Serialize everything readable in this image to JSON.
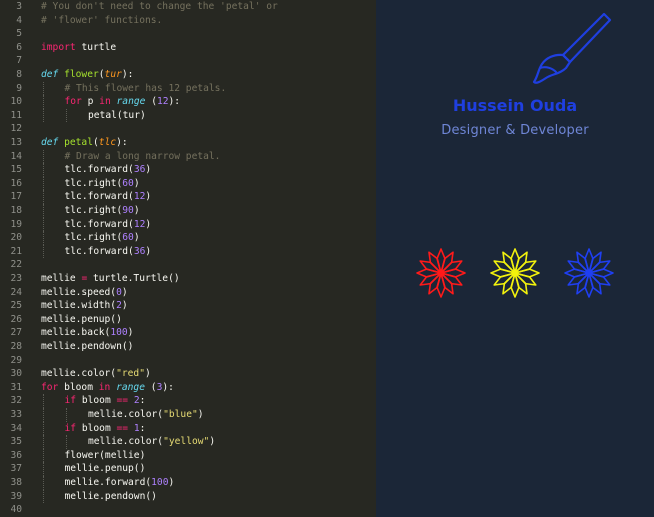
{
  "editor": {
    "lines": [
      {
        "n": "3",
        "indent": 0,
        "tokens": [
          [
            "cmt",
            "# You don't need to change the 'petal' or"
          ]
        ]
      },
      {
        "n": "4",
        "indent": 0,
        "tokens": [
          [
            "cmt",
            "# 'flower' functions."
          ]
        ]
      },
      {
        "n": "5",
        "indent": 0,
        "tokens": []
      },
      {
        "n": "6",
        "indent": 0,
        "tokens": [
          [
            "kw",
            "import"
          ],
          [
            "",
            "turtle"
          ]
        ]
      },
      {
        "n": "7",
        "indent": 0,
        "tokens": []
      },
      {
        "n": "8",
        "indent": 0,
        "tokens": [
          [
            "sto",
            "def"
          ],
          [
            "fn",
            "flower"
          ],
          [
            "",
            "("
          ],
          [
            "par",
            "tur"
          ],
          [
            "",
            "):"
          ]
        ]
      },
      {
        "n": "9",
        "indent": 1,
        "tokens": [
          [
            "cmt",
            "# This flower has 12 petals."
          ]
        ]
      },
      {
        "n": "10",
        "indent": 1,
        "tokens": [
          [
            "kw",
            "for"
          ],
          [
            "",
            "p "
          ],
          [
            "kw",
            "in"
          ],
          [
            "sto",
            "range"
          ],
          [
            "",
            "("
          ],
          [
            "num",
            "12"
          ],
          [
            "",
            "):"
          ]
        ]
      },
      {
        "n": "11",
        "indent": 2,
        "tokens": [
          [
            "",
            "petal(tur)"
          ]
        ]
      },
      {
        "n": "12",
        "indent": 0,
        "tokens": []
      },
      {
        "n": "13",
        "indent": 0,
        "tokens": [
          [
            "sto",
            "def"
          ],
          [
            "fn",
            "petal"
          ],
          [
            "",
            "("
          ],
          [
            "par",
            "tlc"
          ],
          [
            "",
            "):"
          ]
        ]
      },
      {
        "n": "14",
        "indent": 1,
        "tokens": [
          [
            "cmt",
            "# Draw a long narrow petal."
          ]
        ]
      },
      {
        "n": "15",
        "indent": 1,
        "tokens": [
          [
            "",
            "tlc.forward("
          ],
          [
            "num",
            "36"
          ],
          [
            "",
            ")"
          ]
        ]
      },
      {
        "n": "16",
        "indent": 1,
        "tokens": [
          [
            "",
            "tlc.right("
          ],
          [
            "num",
            "60"
          ],
          [
            "",
            ")"
          ]
        ]
      },
      {
        "n": "17",
        "indent": 1,
        "tokens": [
          [
            "",
            "tlc.forward("
          ],
          [
            "num",
            "12"
          ],
          [
            "",
            ")"
          ]
        ]
      },
      {
        "n": "18",
        "indent": 1,
        "tokens": [
          [
            "",
            "tlc.right("
          ],
          [
            "num",
            "90"
          ],
          [
            "",
            ")"
          ]
        ]
      },
      {
        "n": "19",
        "indent": 1,
        "tokens": [
          [
            "",
            "tlc.forward("
          ],
          [
            "num",
            "12"
          ],
          [
            "",
            ")"
          ]
        ]
      },
      {
        "n": "20",
        "indent": 1,
        "tokens": [
          [
            "",
            "tlc.right("
          ],
          [
            "num",
            "60"
          ],
          [
            "",
            ")"
          ]
        ]
      },
      {
        "n": "21",
        "indent": 1,
        "tokens": [
          [
            "",
            "tlc.forward("
          ],
          [
            "num",
            "36"
          ],
          [
            "",
            ")"
          ]
        ]
      },
      {
        "n": "22",
        "indent": 0,
        "tokens": []
      },
      {
        "n": "23",
        "indent": 0,
        "tokens": [
          [
            "",
            "mellie "
          ],
          [
            "kw",
            "="
          ],
          [
            "",
            "turtle.Turtle()"
          ]
        ]
      },
      {
        "n": "24",
        "indent": 0,
        "tokens": [
          [
            "",
            "mellie.speed("
          ],
          [
            "num",
            "0"
          ],
          [
            "",
            ")"
          ]
        ]
      },
      {
        "n": "25",
        "indent": 0,
        "tokens": [
          [
            "",
            "mellie.width("
          ],
          [
            "num",
            "2"
          ],
          [
            "",
            ")"
          ]
        ]
      },
      {
        "n": "26",
        "indent": 0,
        "tokens": [
          [
            "",
            "mellie.penup()"
          ]
        ]
      },
      {
        "n": "27",
        "indent": 0,
        "tokens": [
          [
            "",
            "mellie.back("
          ],
          [
            "num",
            "100"
          ],
          [
            "",
            ")"
          ]
        ]
      },
      {
        "n": "28",
        "indent": 0,
        "tokens": [
          [
            "",
            "mellie.pendown()"
          ]
        ]
      },
      {
        "n": "29",
        "indent": 0,
        "tokens": []
      },
      {
        "n": "30",
        "indent": 0,
        "tokens": [
          [
            "",
            "mellie.color("
          ],
          [
            "str",
            "\"red\""
          ],
          [
            "",
            ")"
          ]
        ]
      },
      {
        "n": "31",
        "indent": 0,
        "tokens": [
          [
            "kw",
            "for"
          ],
          [
            "",
            "bloom "
          ],
          [
            "kw",
            "in"
          ],
          [
            "sto",
            "range"
          ],
          [
            "",
            "("
          ],
          [
            "num",
            "3"
          ],
          [
            "",
            "):"
          ]
        ]
      },
      {
        "n": "32",
        "indent": 1,
        "tokens": [
          [
            "kw",
            "if"
          ],
          [
            "",
            "bloom "
          ],
          [
            "kw",
            "=="
          ],
          [
            "num",
            "2"
          ],
          [
            "",
            ":"
          ]
        ]
      },
      {
        "n": "33",
        "indent": 2,
        "tokens": [
          [
            "",
            "mellie.color("
          ],
          [
            "str",
            "\"blue\""
          ],
          [
            "",
            ")"
          ]
        ]
      },
      {
        "n": "34",
        "indent": 1,
        "tokens": [
          [
            "kw",
            "if"
          ],
          [
            "",
            "bloom "
          ],
          [
            "kw",
            "=="
          ],
          [
            "num",
            "1"
          ],
          [
            "",
            ":"
          ]
        ]
      },
      {
        "n": "35",
        "indent": 2,
        "tokens": [
          [
            "",
            "mellie.color("
          ],
          [
            "str",
            "\"yellow\""
          ],
          [
            "",
            ")"
          ]
        ]
      },
      {
        "n": "36",
        "indent": 1,
        "tokens": [
          [
            "",
            "flower(mellie)"
          ]
        ]
      },
      {
        "n": "37",
        "indent": 1,
        "tokens": [
          [
            "",
            "mellie.penup()"
          ]
        ]
      },
      {
        "n": "38",
        "indent": 1,
        "tokens": [
          [
            "",
            "mellie.forward("
          ],
          [
            "num",
            "100"
          ],
          [
            "",
            ")"
          ]
        ]
      },
      {
        "n": "39",
        "indent": 1,
        "tokens": [
          [
            "",
            "mellie.pendown()"
          ]
        ]
      },
      {
        "n": "40",
        "indent": 0,
        "tokens": []
      }
    ]
  },
  "preview": {
    "brand_name": "Hussein Ouda",
    "brand_subtitle": "Designer & Developer",
    "logo_icon": "paintbrush-icon",
    "flowers": [
      {
        "color": "#ff1a1a",
        "petals": 12
      },
      {
        "color": "#f2f20d",
        "petals": 12
      },
      {
        "color": "#1f3ff2",
        "petals": 12
      }
    ]
  }
}
